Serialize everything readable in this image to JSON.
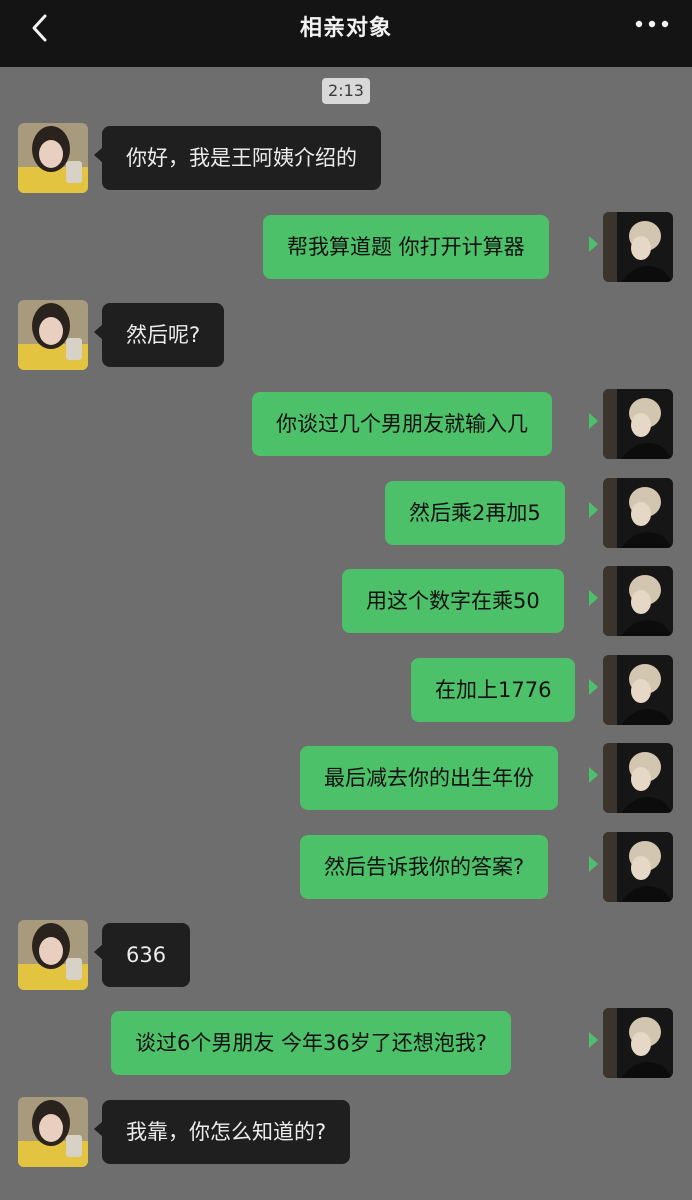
{
  "header": {
    "back_icon": "chevron-left-icon",
    "title": "相亲对象",
    "more_icon": "more-dots-icon"
  },
  "timestamp": "2:13",
  "colors": {
    "background": "#6e6e6e",
    "topbar": "#141414",
    "incoming_bubble": "#1f1f1f",
    "outgoing_bubble": "#4dc06a"
  },
  "messages": [
    {
      "side": "left",
      "text": "你好，我是王阿姨介绍的"
    },
    {
      "side": "right",
      "text": "帮我算道题  你打开计算器"
    },
    {
      "side": "left",
      "text": "然后呢?"
    },
    {
      "side": "right",
      "text": "你谈过几个男朋友就输入几"
    },
    {
      "side": "right",
      "text": "然后乘2再加5"
    },
    {
      "side": "right",
      "text": "用这个数字在乘50"
    },
    {
      "side": "right",
      "text": "在加上1776"
    },
    {
      "side": "right",
      "text": "最后减去你的出生年份"
    },
    {
      "side": "right",
      "text": "然后告诉我你的答案?"
    },
    {
      "side": "left",
      "text": "636"
    },
    {
      "side": "right",
      "text": "谈过6个男朋友  今年36岁了还想泡我?"
    },
    {
      "side": "left",
      "text": "我靠，你怎么知道的?"
    }
  ]
}
